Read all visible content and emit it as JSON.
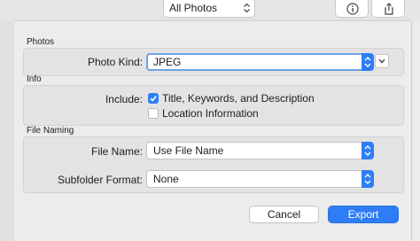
{
  "toolbar": {
    "library_select": "All Photos",
    "info_icon": "info-icon",
    "share_icon": "share-icon"
  },
  "sections": {
    "photos_title": "Photos",
    "info_title": "Info",
    "naming_title": "File Naming"
  },
  "photo_kind": {
    "label": "Photo Kind:",
    "value": "JPEG"
  },
  "include": {
    "label": "Include:",
    "options": [
      {
        "label": "Title, Keywords, and Description",
        "checked": true
      },
      {
        "label": "Location Information",
        "checked": false
      }
    ]
  },
  "file_name": {
    "label": "File Name:",
    "value": "Use File Name"
  },
  "subfolder": {
    "label": "Subfolder Format:",
    "value": "None"
  },
  "buttons": {
    "cancel": "Cancel",
    "export": "Export"
  },
  "colors": {
    "accent": "#2f7df6",
    "focus_ring": "#6ea4e6"
  }
}
